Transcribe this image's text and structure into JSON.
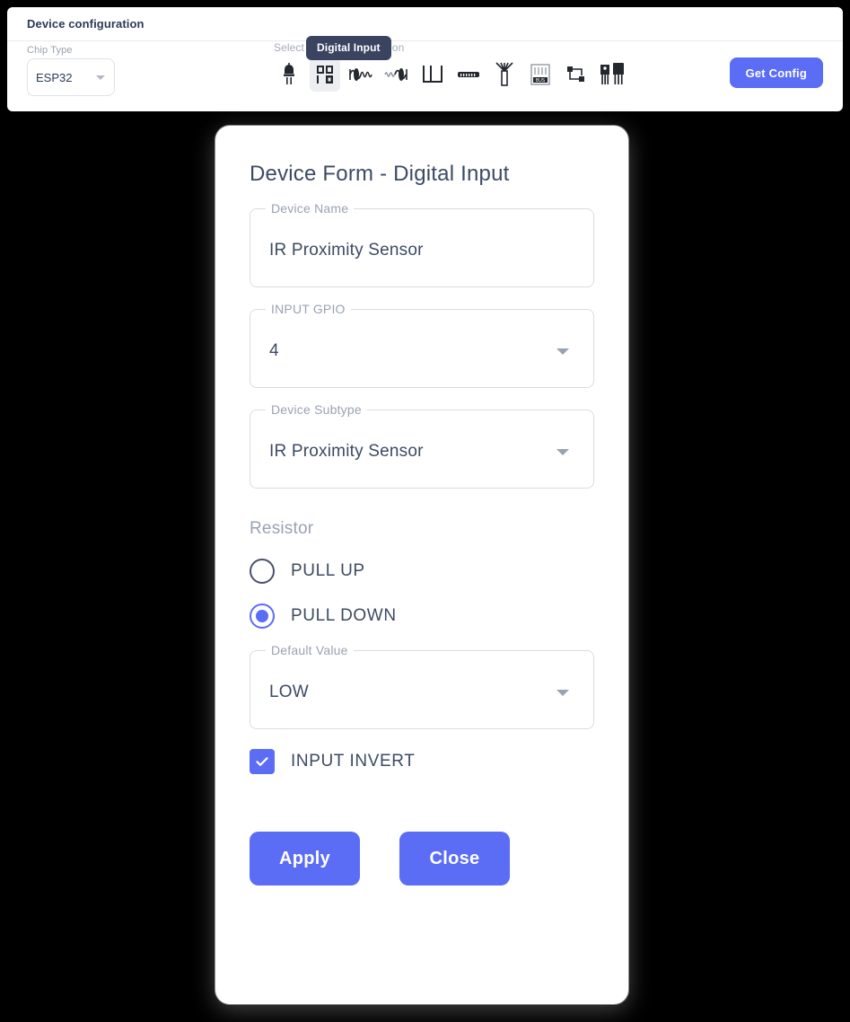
{
  "colors": {
    "accent": "#5b6cf5",
    "tooltip_bg": "#3a4461",
    "text_primary": "#3d4a63",
    "text_muted": "#9aa2b1",
    "page_bg": "#000000",
    "panel_bg": "#ffffff",
    "selected_tool_bg": "#eceef1"
  },
  "config_panel": {
    "header_title": "Device configuration",
    "chip_type": {
      "label": "Chip Type",
      "value": "ESP32",
      "options": [
        "ESP32"
      ]
    },
    "toolbar": {
      "caption": "Select a New configuration",
      "tooltip": "Digital Input",
      "items": [
        {
          "name": "led-icon",
          "label": "LED",
          "selected": false
        },
        {
          "name": "digital-input-icon",
          "label": "Digital Input",
          "selected": true
        },
        {
          "name": "analog-signal-icon",
          "label": "Analog Input",
          "selected": false
        },
        {
          "name": "waveform-icon",
          "label": "Analog Output",
          "selected": false
        },
        {
          "name": "pulse-square-icon",
          "label": "PWM",
          "selected": false
        },
        {
          "name": "connector-icon",
          "label": "Connector",
          "selected": false
        },
        {
          "name": "antenna-icon",
          "label": "Antenna",
          "selected": false
        },
        {
          "name": "bus-icon",
          "label": "Bus",
          "selected": false
        },
        {
          "name": "network-icon",
          "label": "Network",
          "selected": false
        },
        {
          "name": "transistor-icon",
          "label": "Transistor",
          "selected": false
        }
      ]
    },
    "get_config_label": "Get Config"
  },
  "dialog": {
    "title": "Device Form - Digital Input",
    "fields": {
      "device_name": {
        "label": "Device Name",
        "value": "IR Proximity Sensor",
        "type": "text"
      },
      "input_gpio": {
        "label": "INPUT GPIO",
        "value": "4",
        "type": "select"
      },
      "device_subtype": {
        "label": "Device Subtype",
        "value": "IR Proximity Sensor",
        "type": "select"
      },
      "default_value": {
        "label": "Default Value",
        "value": "LOW",
        "type": "select"
      }
    },
    "resistor": {
      "group_label": "Resistor",
      "options": [
        {
          "label": "PULL UP",
          "checked": false
        },
        {
          "label": "PULL DOWN",
          "checked": true
        }
      ]
    },
    "input_invert": {
      "label": "INPUT INVERT",
      "checked": true
    },
    "actions": {
      "apply_label": "Apply",
      "close_label": "Close"
    }
  }
}
